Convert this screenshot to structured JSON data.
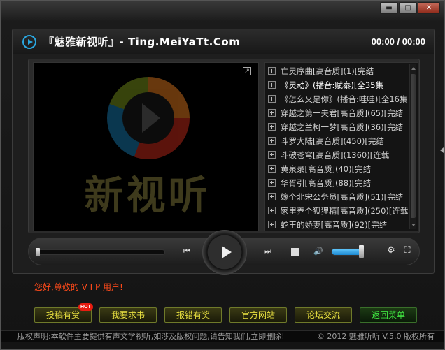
{
  "window": {
    "buttons": {
      "minimize": "▬",
      "maximize": "□",
      "close": "✕"
    }
  },
  "header": {
    "title": "『魅雅新视听』- Ting.MeiYaTt.Com",
    "time": "00:00 / 00:00"
  },
  "video": {
    "brand_text": "新视听"
  },
  "playlist": [
    {
      "label": "亡灵序曲[高音质](1)[完结",
      "active": false
    },
    {
      "label": "《灵动》(播音:赋泰)[全35集",
      "active": true
    },
    {
      "label": "《怎么又是你》(播音:哇哇)[全16集",
      "active": false
    },
    {
      "label": "穿越之第一夫君[高音质](65)[完结",
      "active": false
    },
    {
      "label": "穿越之兰柯一梦[高音质](36)[完结",
      "active": false
    },
    {
      "label": "斗罗大陆[高音质](450)[完结",
      "active": false
    },
    {
      "label": "斗破苍穹[高音质](1360)[连载",
      "active": false
    },
    {
      "label": "黄泉录[高音质](40)[完结",
      "active": false
    },
    {
      "label": "华胥引[高音质](88)[完结",
      "active": false
    },
    {
      "label": "嫁个北宋公务员[高音质](51)[完结",
      "active": false
    },
    {
      "label": "家里养个狐狸精[高音质](250)[连载",
      "active": false
    },
    {
      "label": "蛇王的娇妻[高音质](92)[完结",
      "active": false
    }
  ],
  "controls": {
    "progress": 0,
    "volume": 0.9,
    "icons": {
      "prev": "⏮",
      "next": "⏭",
      "volume": "🔊",
      "settings": "⚙",
      "fullscreen": "⛶"
    }
  },
  "welcome": "您好,尊敬的 V I P 用户!",
  "buttons": [
    {
      "label": "投稿有赏",
      "hot": "HOT",
      "style": "yellow"
    },
    {
      "label": "我要求书",
      "style": "yellow"
    },
    {
      "label": "报错有奖",
      "style": "yellow"
    },
    {
      "label": "官方网站",
      "style": "yellow"
    },
    {
      "label": "论坛交流",
      "style": "yellow"
    },
    {
      "label": "返回菜单",
      "style": "green"
    }
  ],
  "footer": {
    "left": "版权声明:本软件主要提供有声文学视听,如涉及版权问题,请告知我们,立即删除!",
    "right": "© 2012 魅雅听听 V.5.0 版权所有"
  }
}
